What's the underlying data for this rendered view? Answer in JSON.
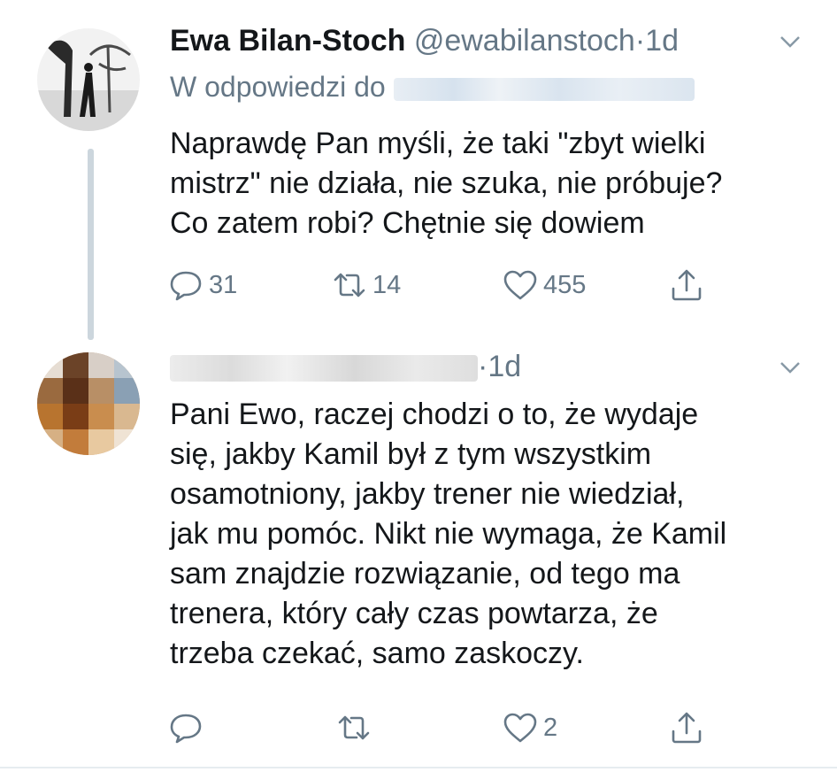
{
  "tweet1": {
    "name": "Ewa Bilan-Stoch",
    "handle": "@ewabilanstoch",
    "dot": "·",
    "time": "1d",
    "reply_prefix": "W odpowiedzi do",
    "lines": [
      "Naprawdę Pan myśli, że taki \"zbyt wielki",
      "mistrz\" nie działa, nie szuka, nie próbuje?",
      "Co zatem robi? Chętnie się dowiem"
    ],
    "reply_count": "31",
    "retweet_count": "14",
    "like_count": "455"
  },
  "tweet2": {
    "dot": "·",
    "time": "1d",
    "lines": [
      "Pani Ewo, raczej chodzi o to, że wydaje",
      "się, jakby Kamil był z tym wszystkim",
      "osamotniony, jakby trener nie wiedział,",
      "jak mu pomóc. Nikt nie wymaga, że Kamil",
      "sam znajdzie rozwiązanie, od tego ma",
      "trenera, który cały czas powtarza, że",
      "trzeba czekać, samo zaskoczy."
    ],
    "like_count": "2"
  },
  "colors": {
    "text": "#14171a",
    "secondary": "#657786",
    "thread_line": "#ccd6dd"
  },
  "icons": [
    "reply-icon",
    "retweet-icon",
    "like-icon",
    "share-icon",
    "chevron-down-icon"
  ]
}
